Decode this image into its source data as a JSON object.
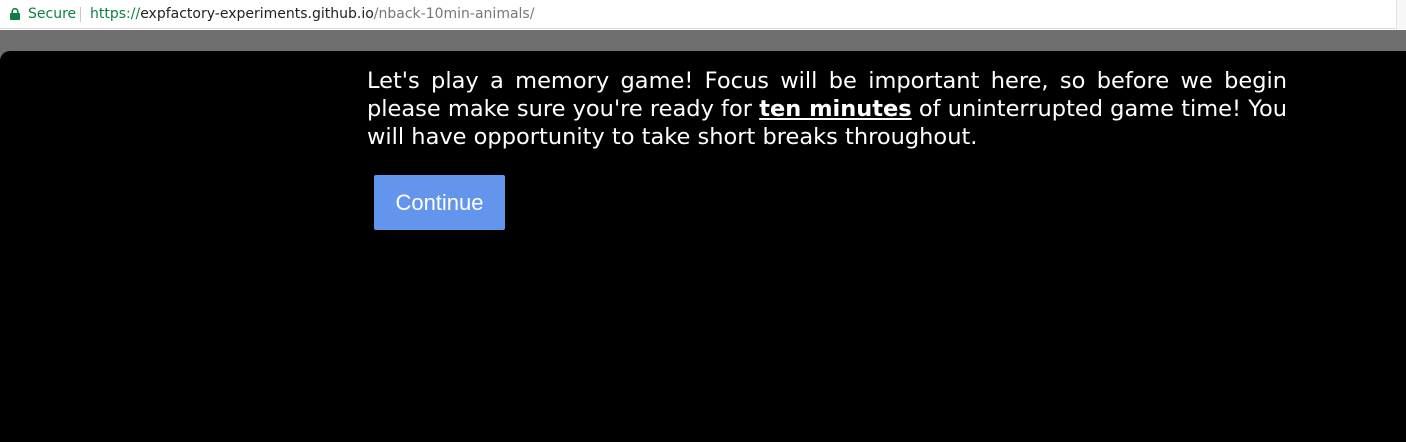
{
  "browser": {
    "security_label": "Secure",
    "url": {
      "scheme": "https://",
      "host": "expfactory-experiments.github.io",
      "path": "/nback-10min-animals/"
    },
    "icons": {
      "lock": "lock-icon"
    },
    "colors": {
      "secure_green": "#0b8043"
    }
  },
  "instructions": {
    "text_before": "Let's play a memory game! Focus will be important here, so before we begin please make sure you're ready for ",
    "emphasis": "ten minutes",
    "text_after": " of uninterrupted game time! You will have opportunity to take short breaks throughout."
  },
  "continue_button": {
    "label": "Continue",
    "color": "#6495ed"
  },
  "page": {
    "background": "#000000"
  }
}
